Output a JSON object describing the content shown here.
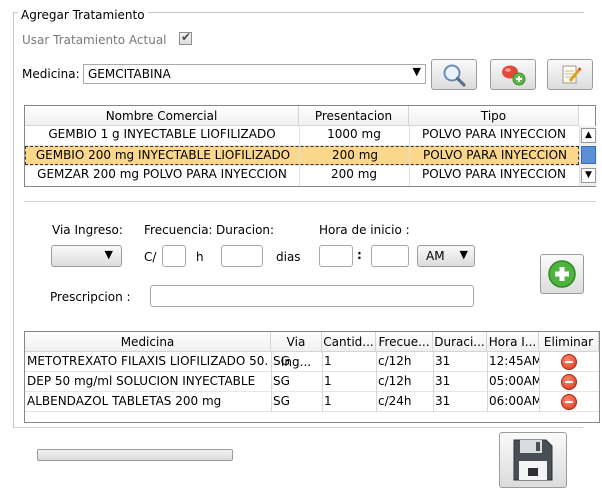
{
  "group_title": "Agregar Tratamiento",
  "use_current": {
    "label": "Usar Tratamiento Actual",
    "checked": true
  },
  "medicina": {
    "label": "Medicina:",
    "value": "GEMCITABINA"
  },
  "product_grid": {
    "headers": [
      "Nombre Comercial",
      "Presentacion",
      "Tipo"
    ],
    "rows": [
      [
        "GEMBIO 1 g INYECTABLE LIOFILIZADO",
        "1000 mg",
        "POLVO PARA INYECCION"
      ],
      [
        "GEMBIO 200 mg INYECTABLE LIOFILIZADO",
        "200 mg",
        "POLVO PARA INYECCION"
      ],
      [
        "GEMZAR 200 mg POLVO PARA INYECCION",
        "200 mg",
        "POLVO PARA INYECCION"
      ]
    ],
    "selected_index": 1
  },
  "dosing": {
    "via_label": "Via Ingreso:",
    "frecuencia_label": "Frecuencia:",
    "duracion_label": "Duracion:",
    "hora_label": "Hora de inicio :",
    "c_label": "C/",
    "h_label": "h",
    "dias_label": "dias",
    "colon": ":",
    "ampm_value": "AM",
    "prescripcion_label": "Prescripcion :"
  },
  "treatment_grid": {
    "headers": [
      "Medicina",
      "Via Ing...",
      "Cantid...",
      "Frecue...",
      "Duraci...",
      "Hora I...",
      "Eliminar"
    ],
    "rows": [
      [
        "METOTREXATO FILAXIS LIOFILIZADO 50...",
        "SG",
        "1",
        "c/12h",
        "31",
        "12:45AM"
      ],
      [
        "DEP 50 mg/ml SOLUCION INYECTABLE",
        "SG",
        "1",
        "c/12h",
        "31",
        "05:00AM"
      ],
      [
        "ALBENDAZOL TABLETAS 200 mg",
        "SG",
        "1",
        "c/24h",
        "31",
        "06:00AM"
      ]
    ]
  },
  "icons": {
    "search": "magnifier-icon",
    "add_medicine": "pill-add-icon",
    "edit": "notepad-edit-icon",
    "add": "plus-circle-icon",
    "save": "floppy-disk-icon",
    "delete": "minus-circle-icon"
  }
}
